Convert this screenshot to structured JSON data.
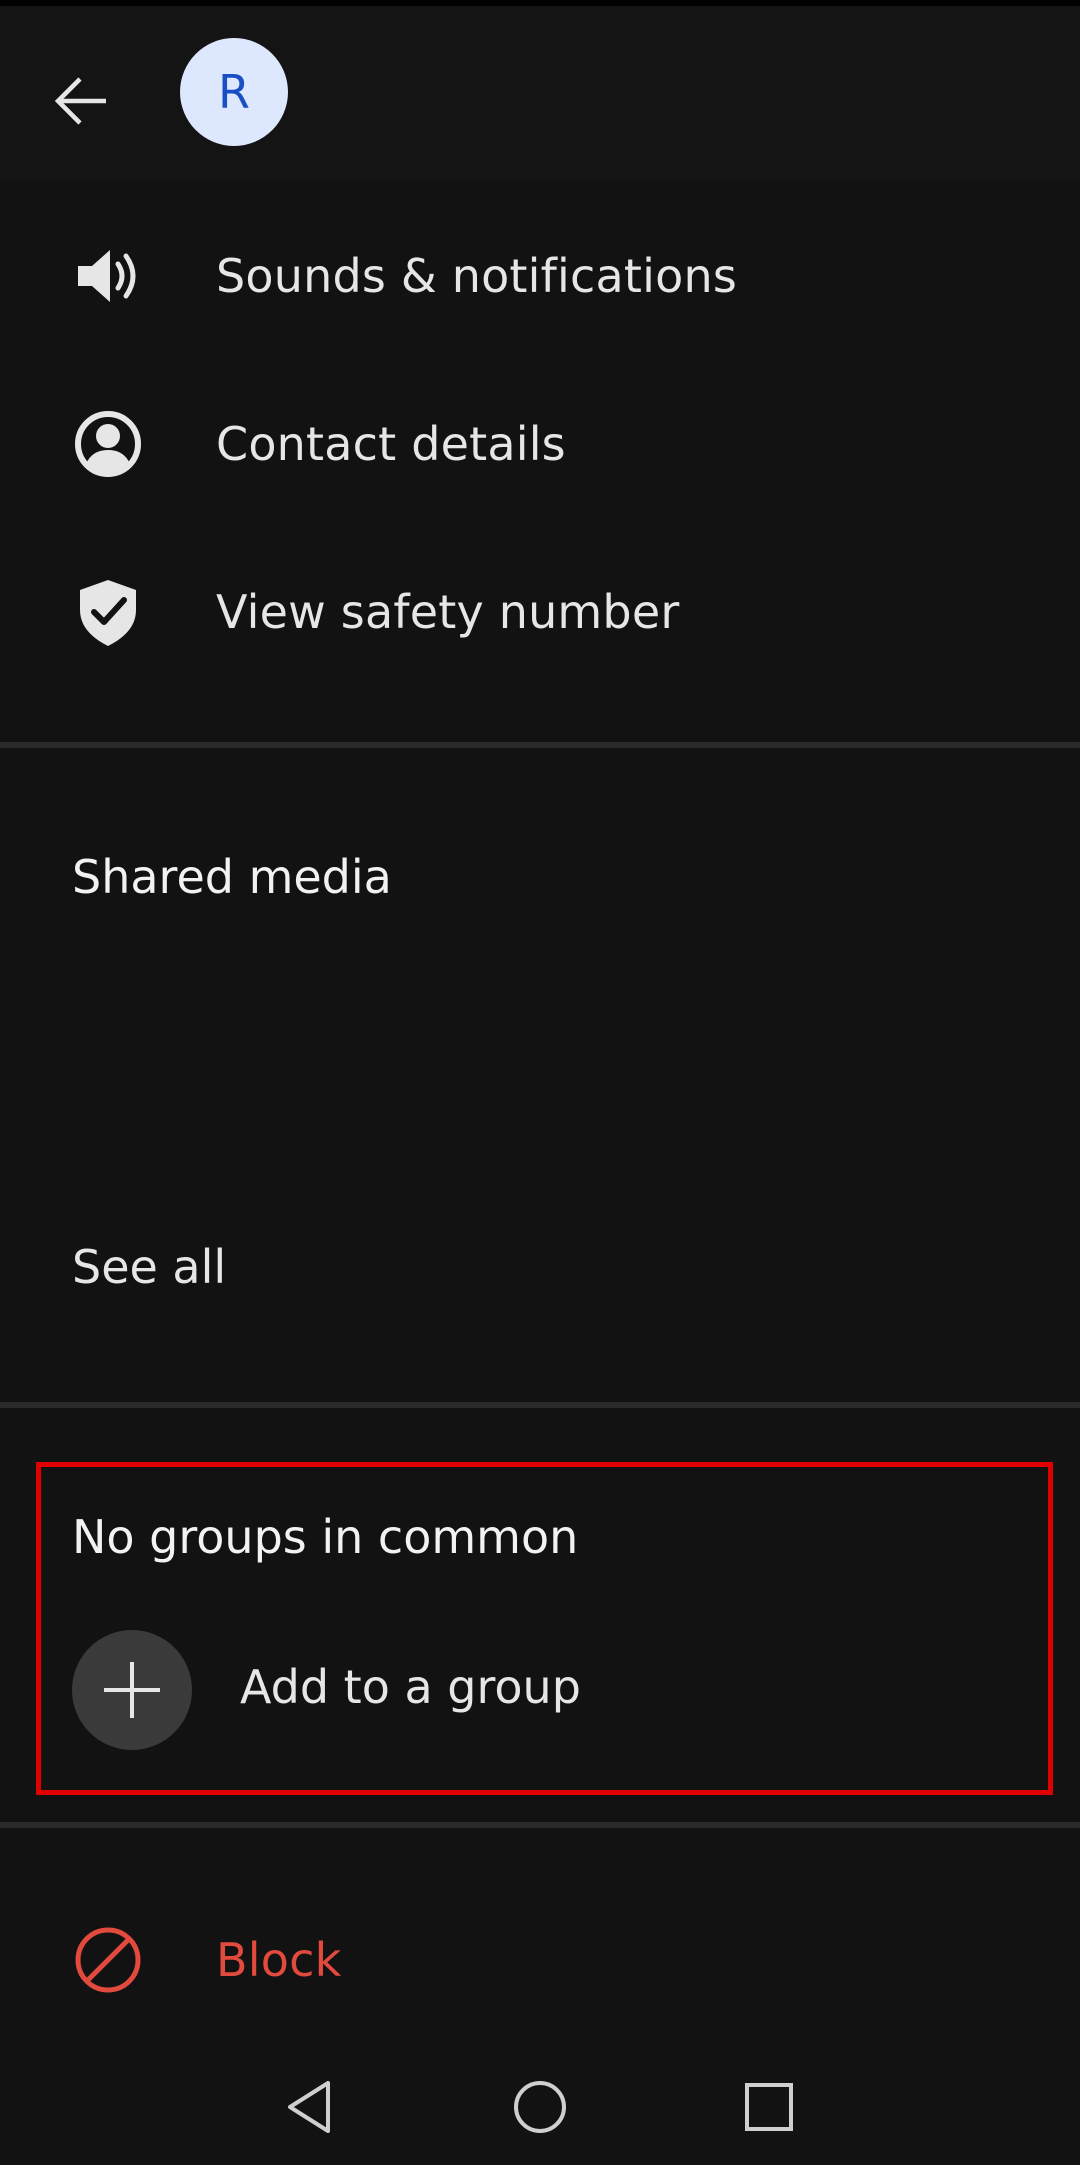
{
  "header": {
    "back_icon": "arrow-left-icon",
    "avatar_initial": "R",
    "avatar_bg": "#dde8ff",
    "avatar_fg": "#1a4fc4"
  },
  "settings": [
    {
      "label": "Sounds & notifications",
      "icon": "speaker-icon"
    },
    {
      "label": "Contact details",
      "icon": "person-circle-icon"
    },
    {
      "label": "View safety number",
      "icon": "shield-check-icon"
    }
  ],
  "shared_media": {
    "title": "Shared media",
    "see_all_label": "See all"
  },
  "groups": {
    "title": "No groups in common",
    "add_label": "Add to a group",
    "add_icon": "plus-icon"
  },
  "block": {
    "label": "Block",
    "icon": "block-icon",
    "color": "#e24a3d"
  },
  "highlight_color": "#e00000",
  "navbar": {
    "icons": [
      "nav-back-icon",
      "nav-home-icon",
      "nav-recents-icon"
    ]
  }
}
